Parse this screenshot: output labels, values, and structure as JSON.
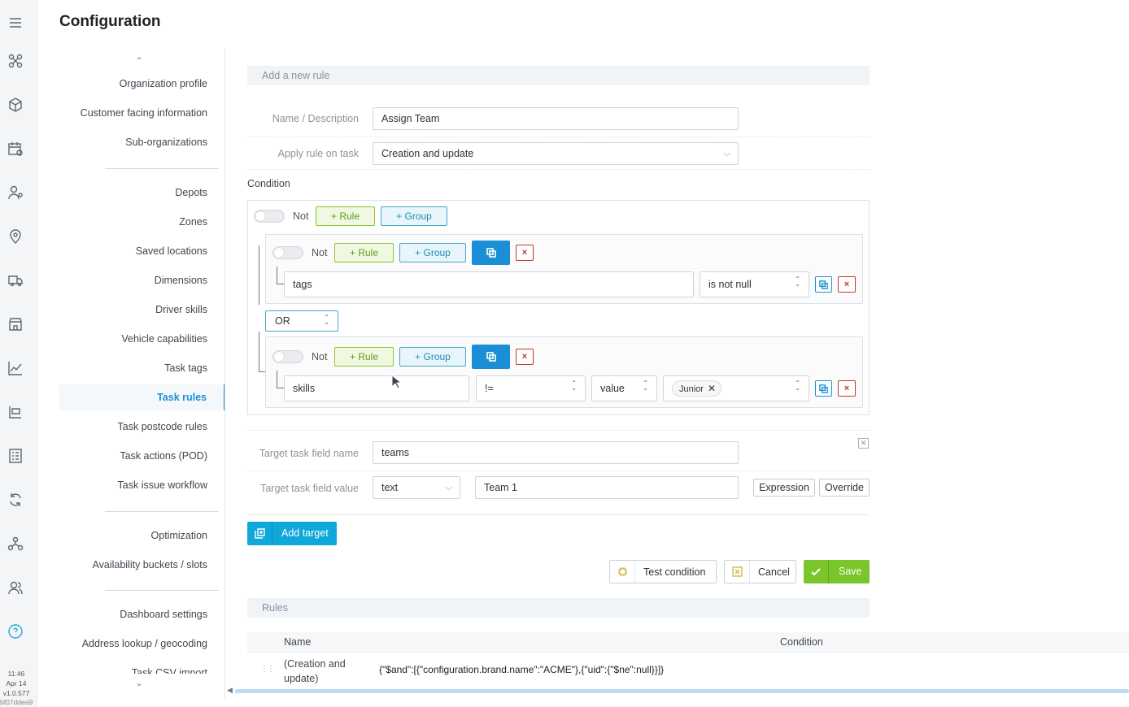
{
  "app": {
    "title": "Configuration",
    "time": "11:46",
    "date": "Apr 14",
    "version": "v1.0.577",
    "build": "bf07ddea9"
  },
  "rail_icons": [
    "menu-icon",
    "integrations-icon",
    "packages-icon",
    "calendar-icon",
    "driver-location-icon",
    "location-pin-icon",
    "delivery-truck-icon",
    "store-icon",
    "analytics-chart-icon",
    "routes-icon",
    "checklist-icon",
    "refresh-sync-icon",
    "network-icon",
    "users-icon",
    "help-icon"
  ],
  "nav": {
    "items_a": [
      "Organization profile",
      "Customer facing information",
      "Sub-organizations"
    ],
    "items_b": [
      "Depots",
      "Zones",
      "Saved locations",
      "Dimensions",
      "Driver skills",
      "Vehicle capabilities",
      "Task tags",
      "Task rules",
      "Task postcode rules",
      "Task actions (POD)",
      "Task issue workflow"
    ],
    "items_c": [
      "Optimization",
      "Availability buckets / slots"
    ],
    "items_d": [
      "Dashboard settings",
      "Address lookup / geocoding",
      "Task CSV import"
    ],
    "active": "Task rules"
  },
  "form": {
    "section_title": "Add a new rule",
    "name_label": "Name / Description",
    "name_value": "Assign Team",
    "apply_label": "Apply rule on task",
    "apply_value": "Creation and update",
    "condition_label": "Condition",
    "not_label": "Not",
    "add_rule": "+ Rule",
    "add_group": "+ Group",
    "delete_symbol": "×",
    "group1": {
      "field": "tags",
      "operator": "is not null"
    },
    "combinator": "OR",
    "group2": {
      "field": "skills",
      "operator": "!=",
      "value_type": "value",
      "value_chip": "Junior"
    },
    "target_name_label": "Target task field name",
    "target_name_value": "teams",
    "target_value_label": "Target task field value",
    "target_value_type": "text",
    "target_value": "Team 1",
    "expression_btn": "Expression",
    "override_btn": "Override",
    "add_target": "Add target",
    "test_condition": "Test condition",
    "cancel": "Cancel",
    "save": "Save"
  },
  "rules": {
    "section_title": "Rules",
    "columns": [
      "Name",
      "Condition"
    ],
    "rows": [
      {
        "name": "(Creation and update)",
        "condition": "{\"$and\":[{\"configuration.brand.name\":\"ACME\"},{\"uid\":{\"$ne\":null}}]}"
      }
    ]
  },
  "colors": {
    "primary": "#1a8fd6",
    "rule_green": "#8fc436",
    "save_green": "#7ac52b",
    "danger": "#c0392b",
    "add_target": "#10a7db"
  }
}
